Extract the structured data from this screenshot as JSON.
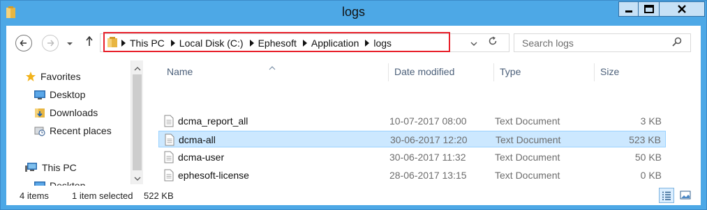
{
  "window": {
    "title": "logs",
    "buttons": {
      "minimize": "minimize",
      "maximize": "maximize",
      "close": "close"
    }
  },
  "address": {
    "crumbs": [
      "This PC",
      "Local Disk (C:)",
      "Ephesoft",
      "Application",
      "logs"
    ],
    "highlight_color": "#e8202a"
  },
  "search": {
    "placeholder": "Search logs"
  },
  "navpane": {
    "favorites": {
      "label": "Favorites"
    },
    "items": [
      {
        "label": "Desktop",
        "icon": "desktop-icon"
      },
      {
        "label": "Downloads",
        "icon": "downloads-folder-icon"
      },
      {
        "label": "Recent places",
        "icon": "recent-places-icon"
      }
    ],
    "thispc": {
      "label": "This PC"
    },
    "partial": {
      "label": "Desktop"
    }
  },
  "columns": {
    "name": "Name",
    "date": "Date modified",
    "type": "Type",
    "size": "Size"
  },
  "files": [
    {
      "name": "dcma_report_all",
      "date": "10-07-2017 08:00",
      "type": "Text Document",
      "size": "3 KB",
      "selected": false
    },
    {
      "name": "dcma-all",
      "date": "30-06-2017 12:20",
      "type": "Text Document",
      "size": "523 KB",
      "selected": true
    },
    {
      "name": "dcma-user",
      "date": "30-06-2017 11:32",
      "type": "Text Document",
      "size": "50 KB",
      "selected": false
    },
    {
      "name": "ephesoft-license",
      "date": "28-06-2017 13:15",
      "type": "Text Document",
      "size": "0 KB",
      "selected": false
    }
  ],
  "status": {
    "count": "4 items",
    "selection": "1 item selected",
    "selection_size": "522 KB"
  },
  "colors": {
    "window_border": "#4da8e6",
    "selection_bg": "#cce8ff",
    "selection_border": "#99d1ff"
  }
}
